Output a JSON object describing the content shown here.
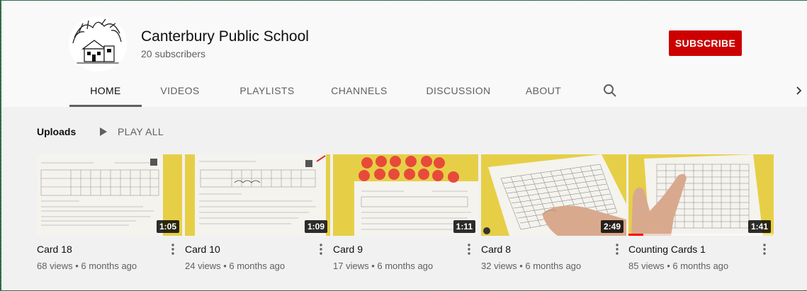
{
  "channel": {
    "name": "Canterbury Public School",
    "subscribers": "20 subscribers",
    "subscribe_label": "SUBSCRIBE",
    "avatar_icon": "school-crest-icon"
  },
  "tabs": [
    {
      "label": "HOME",
      "active": true
    },
    {
      "label": "VIDEOS"
    },
    {
      "label": "PLAYLISTS"
    },
    {
      "label": "CHANNELS"
    },
    {
      "label": "DISCUSSION"
    },
    {
      "label": "ABOUT"
    }
  ],
  "icons": {
    "search": "search-icon",
    "next": "chevron-right-icon",
    "play": "play-icon",
    "more": "kebab-menu-icon"
  },
  "shelf": {
    "title": "Uploads",
    "play_all": "PLAY ALL",
    "videos": [
      {
        "title": "Card 18",
        "meta": "68 views • 6 months ago",
        "duration": "1:05"
      },
      {
        "title": "Card 10",
        "meta": "24 views • 6 months ago",
        "duration": "1:09"
      },
      {
        "title": "Card 9",
        "meta": "17 views • 6 months ago",
        "duration": "1:11"
      },
      {
        "title": "Card 8",
        "meta": "32 views • 6 months ago",
        "duration": "2:49"
      },
      {
        "title": "Counting Cards 1",
        "meta": "85 views • 6 months ago",
        "duration": "1:41",
        "watched_fraction": 0.1
      }
    ]
  },
  "colors": {
    "subscribe": "#cc0000",
    "page": "#f9f9f9",
    "shelf_bg": "#f1f1f1",
    "thumb_yellow": "#e4d04a",
    "counter_red": "#e84a3a"
  }
}
